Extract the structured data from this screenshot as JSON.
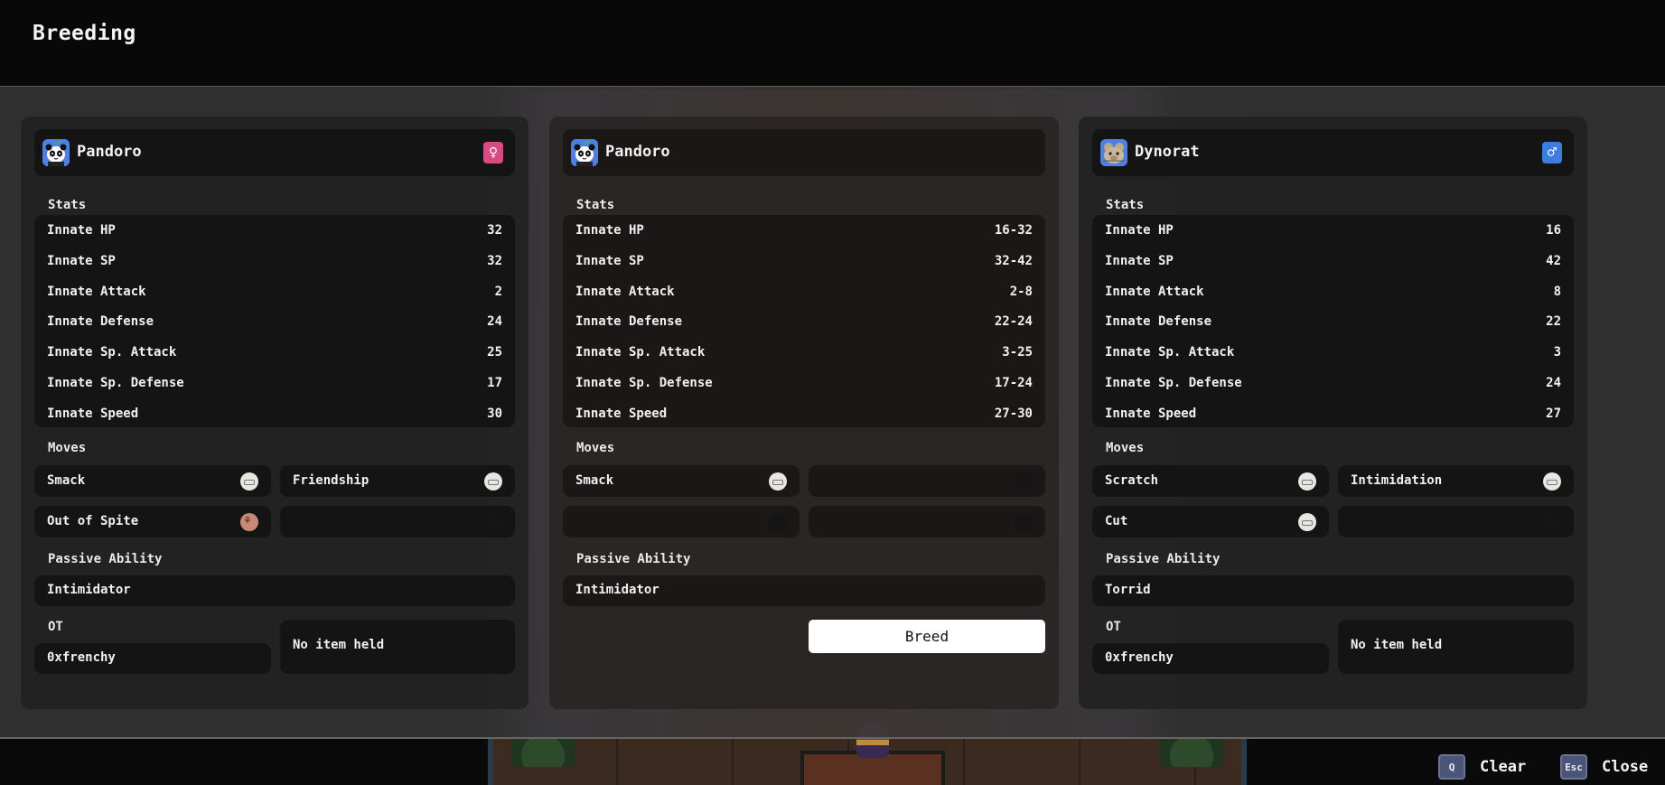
{
  "header": {
    "title": "Breeding"
  },
  "colors": {
    "female": "#d64c82",
    "male": "#3e7de0",
    "accent_button": "#ffffff"
  },
  "parents": [
    {
      "name": "Pandoro",
      "icon": "panda-monster-icon",
      "gender": "female",
      "gender_symbol": "♀",
      "stats_label": "Stats",
      "stats": [
        {
          "label": "Innate HP",
          "value": "32"
        },
        {
          "label": "Innate SP",
          "value": "32"
        },
        {
          "label": "Innate Attack",
          "value": "2"
        },
        {
          "label": "Innate Defense",
          "value": "24"
        },
        {
          "label": "Innate Sp. Attack",
          "value": "25"
        },
        {
          "label": "Innate Sp. Defense",
          "value": "17"
        },
        {
          "label": "Innate Speed",
          "value": "30"
        }
      ],
      "moves_label": "Moves",
      "moves": [
        {
          "name": "Smack",
          "type": "normal"
        },
        {
          "name": "Friendship",
          "type": "normal"
        },
        {
          "name": "Out of Spite",
          "type": "fighting"
        },
        {
          "name": "",
          "type": "empty"
        }
      ],
      "passive_label": "Passive Ability",
      "passive": "Intimidator",
      "ot_label": "OT",
      "ot": "0xfrenchy",
      "held_item": "No item held"
    },
    {
      "name": "Pandoro",
      "icon": "panda-monster-icon",
      "stats_label": "Stats",
      "stats": [
        {
          "label": "Innate HP",
          "value": "16-32"
        },
        {
          "label": "Innate SP",
          "value": "32-42"
        },
        {
          "label": "Innate Attack",
          "value": "2-8"
        },
        {
          "label": "Innate Defense",
          "value": "22-24"
        },
        {
          "label": "Innate Sp. Attack",
          "value": "3-25"
        },
        {
          "label": "Innate Sp. Defense",
          "value": "17-24"
        },
        {
          "label": "Innate Speed",
          "value": "27-30"
        }
      ],
      "moves_label": "Moves",
      "moves": [
        {
          "name": "Smack",
          "type": "normal"
        },
        {
          "name": "",
          "type": "empty"
        },
        {
          "name": "",
          "type": "empty"
        },
        {
          "name": "",
          "type": "empty"
        }
      ],
      "passive_label": "Passive Ability",
      "passive": "Intimidator",
      "breed_label": "Breed"
    },
    {
      "name": "Dynorat",
      "icon": "rat-monster-icon",
      "gender": "male",
      "gender_symbol": "♂",
      "stats_label": "Stats",
      "stats": [
        {
          "label": "Innate HP",
          "value": "16"
        },
        {
          "label": "Innate SP",
          "value": "42"
        },
        {
          "label": "Innate Attack",
          "value": "8"
        },
        {
          "label": "Innate Defense",
          "value": "22"
        },
        {
          "label": "Innate Sp. Attack",
          "value": "3"
        },
        {
          "label": "Innate Sp. Defense",
          "value": "24"
        },
        {
          "label": "Innate Speed",
          "value": "27"
        }
      ],
      "moves_label": "Moves",
      "moves": [
        {
          "name": "Scratch",
          "type": "normal"
        },
        {
          "name": "Intimidation",
          "type": "normal"
        },
        {
          "name": "Cut",
          "type": "normal"
        },
        {
          "name": "",
          "type": "empty"
        }
      ],
      "passive_label": "Passive Ability",
      "passive": "Torrid",
      "ot_label": "OT",
      "ot": "0xfrenchy",
      "held_item": "No item held"
    }
  ],
  "footer": {
    "clear": {
      "key": "Q",
      "label": "Clear"
    },
    "close": {
      "key": "Esc",
      "label": "Close"
    }
  }
}
